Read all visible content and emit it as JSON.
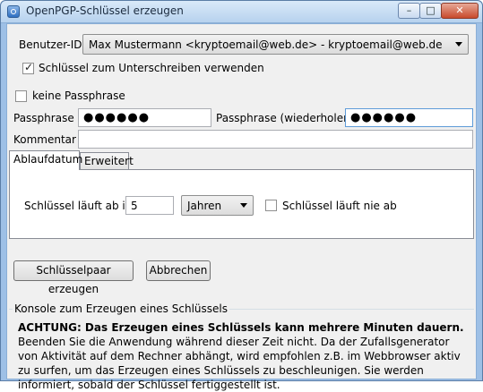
{
  "window": {
    "title": "OpenPGP-Schlüssel erzeugen",
    "minimize_glyph": "–",
    "maximize_glyph": "□",
    "close_glyph": "✕"
  },
  "user_id": {
    "label": "Benutzer-ID",
    "selected": "Max Mustermann <kryptoemail@web.de> - kryptoemail@web.de"
  },
  "signing": {
    "label": "Schlüssel zum Unterschreiben verwenden",
    "checked": true
  },
  "no_passphrase": {
    "label": "keine Passphrase",
    "checked": false
  },
  "passphrase": {
    "label": "Passphrase",
    "value": "●●●●●●"
  },
  "passphrase_repeat": {
    "label": "Passphrase (wiederholen)",
    "value": "●●●●●●"
  },
  "comment": {
    "label": "Kommentar",
    "value": ""
  },
  "tabs": [
    {
      "label": "Ablaufdatum",
      "active": true
    },
    {
      "label": "Erweitert",
      "active": false
    }
  ],
  "expiry": {
    "label": "Schlüssel läuft ab in",
    "value": "5",
    "unit": "Jahren",
    "never_label": "Schlüssel läuft nie ab",
    "never_checked": false
  },
  "buttons": {
    "generate": "Schlüsselpaar erzeugen",
    "cancel": "Abbrechen"
  },
  "console": {
    "title": "Konsole zum Erzeugen eines Schlüssels",
    "warning_bold": "ACHTUNG: Das Erzeugen eines Schlüssels kann mehrere Minuten dauern.",
    "warning_rest": " Beenden Sie die Anwendung während dieser Zeit nicht. Da der Zufallsgenerator von Aktivität auf dem Rechner abhängt, wird empfohlen z.B. im Webbrowser aktiv zu surfen, um das Erzeugen eines Schlüssels zu beschleunigen. Sie werden informiert, sobald der Schlüssel fertiggestellt ist."
  }
}
